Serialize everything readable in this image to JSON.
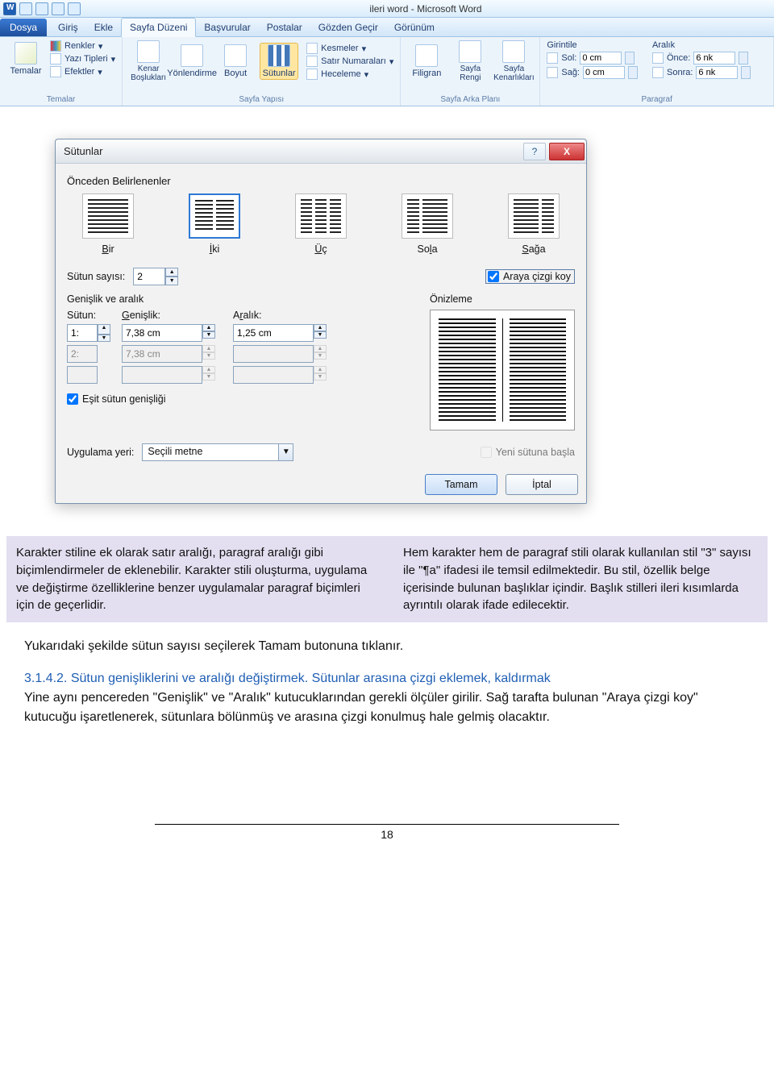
{
  "titlebar": {
    "title": "ileri word - Microsoft Word"
  },
  "tabs": {
    "file": "Dosya",
    "items": [
      "Giriş",
      "Ekle",
      "Sayfa Düzeni",
      "Başvurular",
      "Postalar",
      "Gözden Geçir",
      "Görünüm"
    ],
    "active_index": 2
  },
  "ribbon": {
    "temalar": {
      "group": "Temalar",
      "main": "Temalar",
      "renkler": "Renkler",
      "yazi": "Yazı Tipleri",
      "efekt": "Efektler"
    },
    "sayfa_yapisi": {
      "group": "Sayfa Yapısı",
      "kenar": "Kenar Boşlukları",
      "yon": "Yönlendirme",
      "boyut": "Boyut",
      "sutunlar": "Sütunlar",
      "kesmeler": "Kesmeler",
      "satirno": "Satır Numaraları",
      "heceleme": "Heceleme"
    },
    "arka_plan": {
      "group": "Sayfa Arka Planı",
      "filigran": "Filigran",
      "sayfa_rengi": "Sayfa Rengi",
      "sayfa_kenar": "Sayfa Kenarlıkları"
    },
    "paragraf": {
      "group": "Paragraf",
      "girintile": "Girintile",
      "sol_lbl": "Sol:",
      "sol_val": "0 cm",
      "sag_lbl": "Sağ:",
      "sag_val": "0 cm",
      "aralik": "Aralık",
      "once_lbl": "Önce:",
      "once_val": "6 nk",
      "sonra_lbl": "Sonra:",
      "sonra_val": "6 nk"
    }
  },
  "dialog": {
    "title": "Sütunlar",
    "presets_label": "Önceden Belirlenenler",
    "presets": [
      {
        "label": "Bir",
        "u": "B",
        "rest": "ir"
      },
      {
        "label": "İki",
        "u": "İ",
        "rest": "ki"
      },
      {
        "label": "Üç",
        "u": "Ü",
        "rest": "ç"
      },
      {
        "label": "Sola",
        "u": "l",
        "pre": "So",
        "rest": "a"
      },
      {
        "label": "Sağa",
        "u": "S",
        "rest": "ağa"
      }
    ],
    "sutun_sayisi_lbl": "Sütun sayısı:",
    "sutun_sayisi_val": "2",
    "araya_cizgi": "Araya çizgi koy",
    "gw_lbl": "Genişlik ve aralık",
    "onizleme": "Önizleme",
    "head_sutun": "Sütun:",
    "head_genislik": "Genişlik:",
    "head_aralik": "Aralık:",
    "rows": [
      {
        "n": "1:",
        "g": "7,38 cm",
        "a": "1,25 cm",
        "disabled": false
      },
      {
        "n": "2:",
        "g": "7,38 cm",
        "a": "",
        "disabled": true
      },
      {
        "n": "",
        "g": "",
        "a": "",
        "disabled": true
      }
    ],
    "esit": "Eşit sütun genişliği",
    "uygulama_lbl": "Uygulama yeri:",
    "uygulama_val": "Seçili metne",
    "yeni_sutuna": "Yeni sütuna başla",
    "tamam": "Tamam",
    "iptal": "İptal"
  },
  "para": {
    "left": "Karakter stiline ek olarak satır aralığı, paragraf aralığı gibi biçimlendirmeler de eklenebilir. Karakter stili oluşturma, uygulama ve değiştirme özelliklerine benzer uygulamalar paragraf biçimleri için de geçerlidir.",
    "right": "Hem karakter hem de paragraf stili olarak kullanılan stil \"3\" sayısı ile \"¶a\" ifadesi ile temsil edilmektedir. Bu stil, özellik belge içerisinde bulunan başlıklar içindir. Başlık stilleri ileri kısımlarda ayrıntılı olarak ifade edilecektir."
  },
  "body": {
    "p1": "Yukarıdaki şekilde sütun sayısı seçilerek Tamam butonuna tıklanır.",
    "h": "3.1.4.2. Sütun genişliklerini ve aralığı değiştirmek. Sütunlar arasına çizgi eklemek, kaldırmak",
    "p2": "Yine aynı pencereden \"Genişlik\" ve \"Aralık\" kutucuklarından gerekli ölçüler girilir. Sağ tarafta bulunan \"Araya çizgi koy\" kutucuğu işaretlenerek, sütunlara bölünmüş ve arasına çizgi konulmuş hale gelmiş olacaktır."
  },
  "page_number": "18"
}
